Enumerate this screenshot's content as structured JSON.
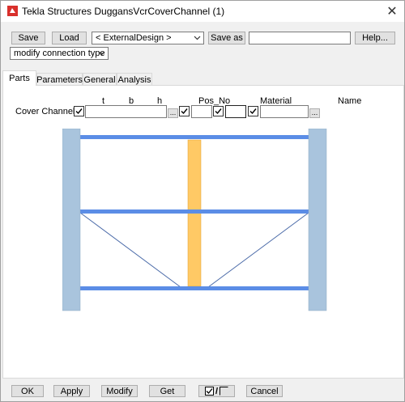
{
  "window": {
    "title": "Tekla Structures  DuggansVcrCoverChannel (1)",
    "close_glyph": "✕"
  },
  "toolbar": {
    "save_label": "Save",
    "load_label": "Load",
    "attribute_file_selected": "< ExternalDesign >",
    "save_as_label": "Save as",
    "save_as_value": "",
    "help_label": "Help...",
    "mode_selected": "modify connection type"
  },
  "tabs": [
    {
      "label": "Parts",
      "active": true
    },
    {
      "label": "Parameters",
      "active": false
    },
    {
      "label": "General",
      "active": false
    },
    {
      "label": "Analysis",
      "active": false
    }
  ],
  "parts": {
    "headers": {
      "t": "t",
      "b": "b",
      "h": "h",
      "pos_no": "Pos_No",
      "material": "Material",
      "name": "Name"
    },
    "row": {
      "label": "Cover Channel",
      "profile_value": "",
      "pos_prefix": "",
      "pos_start": "",
      "material_value": "",
      "dots_label": "..."
    }
  },
  "footer": {
    "ok_label": "OK",
    "apply_label": "Apply",
    "modify_label": "Modify",
    "get_label": "Get",
    "toggle_label": "/",
    "cancel_label": "Cancel"
  },
  "colors": {
    "column": "#a9c4dd",
    "beam": "#5b8de6",
    "stiffener": "#ffc965",
    "brace": "#4a6aa8"
  }
}
